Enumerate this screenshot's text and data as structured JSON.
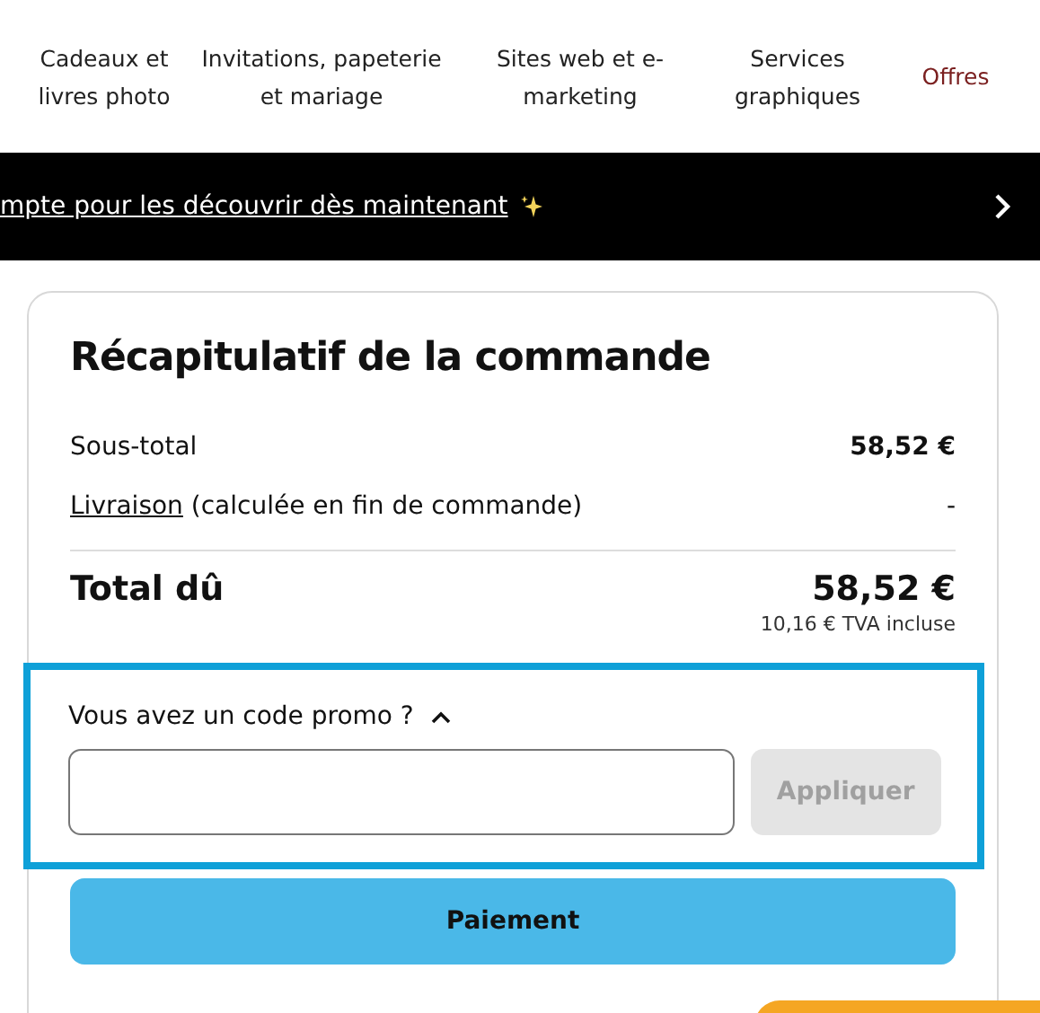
{
  "nav": {
    "items": [
      {
        "label": "Cadeaux et livres photo",
        "highlighted": false
      },
      {
        "label": "Invitations, papeterie et mariage",
        "highlighted": false
      },
      {
        "label": "Sites web et e-marketing",
        "highlighted": false
      },
      {
        "label": "Services graphiques",
        "highlighted": false
      },
      {
        "label": "Offres",
        "highlighted": true
      }
    ]
  },
  "banner": {
    "text": "mpte pour les découvrir dès maintenant"
  },
  "summary": {
    "title": "Récapitulatif de la commande",
    "rows": [
      {
        "label": "Sous-total",
        "value": "58,52 €"
      },
      {
        "link": "Livraison",
        "label": "(calculée en fin de commande)",
        "value": "-"
      }
    ],
    "total": {
      "label": "Total dû",
      "value": "58,52 €",
      "tax": "10,16 € TVA incluse"
    },
    "promo": {
      "label": "Vous avez un code promo ?",
      "expanded": true,
      "button": {
        "label": "Appliquer",
        "disabled": true
      }
    },
    "checkout_button": "Paiement"
  }
}
